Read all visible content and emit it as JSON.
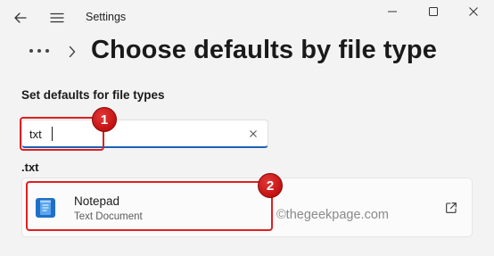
{
  "window": {
    "title": "Settings"
  },
  "breadcrumb": {
    "title": "Choose defaults by file type"
  },
  "section": {
    "label": "Set defaults for file types"
  },
  "search": {
    "value": "txt"
  },
  "results": {
    "extension": ".txt",
    "app": {
      "name": "Notepad",
      "description": "Text Document"
    }
  },
  "watermark": "©thegeekpage.com",
  "annotations": {
    "step1": "1",
    "step2": "2",
    "color": "#e01f1f"
  },
  "colors": {
    "accent": "#1c5fb8",
    "background": "#f3f3f3"
  },
  "icons": [
    "back-arrow-icon",
    "hamburger-menu-icon",
    "minimize-icon",
    "maximize-icon",
    "close-icon",
    "more-dots-icon",
    "chevron-right-icon",
    "clear-icon",
    "notepad-icon",
    "open-external-icon"
  ]
}
